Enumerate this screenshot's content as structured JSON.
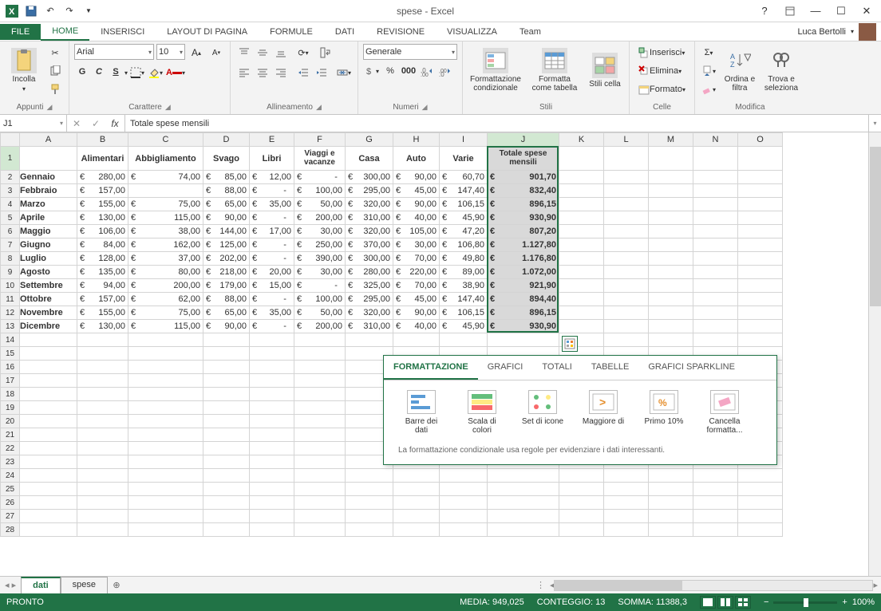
{
  "app": {
    "title": "spese - Excel",
    "user": "Luca Bertolli"
  },
  "tabs": {
    "file": "FILE",
    "home": "HOME",
    "insert": "INSERISCI",
    "layout": "LAYOUT DI PAGINA",
    "formulas": "FORMULE",
    "data": "DATI",
    "review": "REVISIONE",
    "view": "VISUALIZZA",
    "team": "Team"
  },
  "ribbon": {
    "clipboard": {
      "paste": "Incolla",
      "label": "Appunti"
    },
    "font": {
      "name": "Arial",
      "size": "10",
      "label": "Carattere"
    },
    "align": {
      "label": "Allineamento"
    },
    "number": {
      "format": "Generale",
      "label": "Numeri"
    },
    "styles": {
      "cond": "Formattazione condizionale",
      "table": "Formatta come tabella",
      "cell": "Stili cella",
      "label": "Stili"
    },
    "cells": {
      "insert": "Inserisci",
      "delete": "Elimina",
      "format": "Formato",
      "label": "Celle"
    },
    "editing": {
      "sort": "Ordina e filtra",
      "find": "Trova e seleziona",
      "label": "Modifica"
    }
  },
  "formula": {
    "cell": "J1",
    "value": "Totale spese mensili"
  },
  "columns": [
    "A",
    "B",
    "C",
    "D",
    "E",
    "F",
    "G",
    "H",
    "I",
    "J",
    "K",
    "L",
    "M",
    "N",
    "O"
  ],
  "col_widths": {
    "A": 72,
    "B": 64,
    "C": 94,
    "D": 58,
    "E": 56,
    "F": 64,
    "G": 60,
    "H": 58,
    "I": 60,
    "J": 90,
    "K": 56,
    "L": 56,
    "M": 56,
    "N": 56,
    "O": 56
  },
  "headers_row": [
    "",
    "Alimentari",
    "Abbigliamento",
    "Svago",
    "Libri",
    "Viaggi e vacanze",
    "Casa",
    "Auto",
    "Varie",
    "Totale spese mensili"
  ],
  "months": [
    "Gennaio",
    "Febbraio",
    "Marzo",
    "Aprile",
    "Maggio",
    "Giugno",
    "Luglio",
    "Agosto",
    "Settembre",
    "Ottobre",
    "Novembre",
    "Dicembre"
  ],
  "data": [
    [
      "280,00",
      "74,00",
      "85,00",
      "12,00",
      "-",
      "300,00",
      "90,00",
      "60,70",
      "901,70"
    ],
    [
      "157,00",
      "",
      "88,00",
      "-",
      "100,00",
      "295,00",
      "45,00",
      "147,40",
      "832,40"
    ],
    [
      "155,00",
      "75,00",
      "65,00",
      "35,00",
      "50,00",
      "320,00",
      "90,00",
      "106,15",
      "896,15"
    ],
    [
      "130,00",
      "115,00",
      "90,00",
      "-",
      "200,00",
      "310,00",
      "40,00",
      "45,90",
      "930,90"
    ],
    [
      "106,00",
      "38,00",
      "144,00",
      "17,00",
      "30,00",
      "320,00",
      "105,00",
      "47,20",
      "807,20"
    ],
    [
      "84,00",
      "162,00",
      "125,00",
      "-",
      "250,00",
      "370,00",
      "30,00",
      "106,80",
      "1.127,80"
    ],
    [
      "128,00",
      "37,00",
      "202,00",
      "-",
      "390,00",
      "300,00",
      "70,00",
      "49,80",
      "1.176,80"
    ],
    [
      "135,00",
      "80,00",
      "218,00",
      "20,00",
      "30,00",
      "280,00",
      "220,00",
      "89,00",
      "1.072,00"
    ],
    [
      "94,00",
      "200,00",
      "179,00",
      "15,00",
      "-",
      "325,00",
      "70,00",
      "38,90",
      "921,90"
    ],
    [
      "157,00",
      "62,00",
      "88,00",
      "-",
      "100,00",
      "295,00",
      "45,00",
      "147,40",
      "894,40"
    ],
    [
      "155,00",
      "75,00",
      "65,00",
      "35,00",
      "50,00",
      "320,00",
      "90,00",
      "106,15",
      "896,15"
    ],
    [
      "130,00",
      "115,00",
      "90,00",
      "-",
      "200,00",
      "310,00",
      "40,00",
      "45,90",
      "930,90"
    ]
  ],
  "qa": {
    "tabs": {
      "format": "FORMATTAZIONE",
      "charts": "GRAFICI",
      "totals": "TOTALI",
      "tables": "TABELLE",
      "spark": "GRAFICI SPARKLINE"
    },
    "items": {
      "bars": "Barre dei dati",
      "scale": "Scala di colori",
      "icons": "Set di icone",
      "greater": "Maggiore di",
      "top10": "Primo 10%",
      "clear": "Cancella formatta..."
    },
    "hint": "La formattazione condizionale usa regole per evidenziare i dati interessanti."
  },
  "sheets": {
    "a": "dati",
    "b": "spese"
  },
  "status": {
    "ready": "PRONTO",
    "avg": "MEDIA: 949,025",
    "count": "CONTEGGIO: 13",
    "sum": "SOMMA: 11388,3",
    "zoom": "100%"
  }
}
